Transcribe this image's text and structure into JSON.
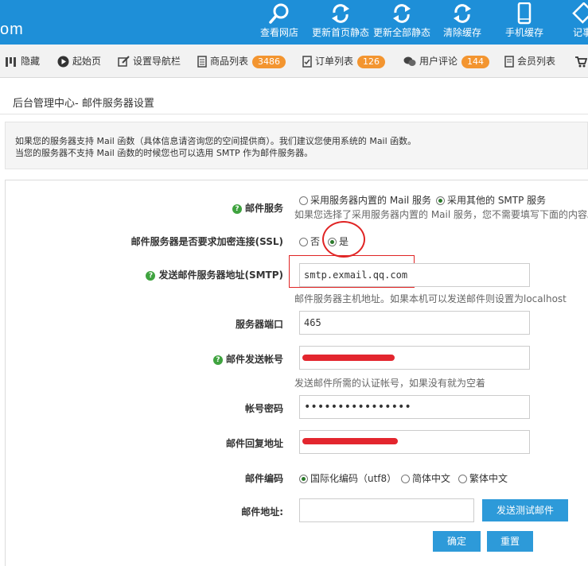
{
  "header": {
    "brand": "om",
    "items": [
      {
        "label": "查看网店",
        "icon": "search-icon"
      },
      {
        "label": "更新首页静态",
        "icon": "refresh-icon"
      },
      {
        "label": "更新全部静态",
        "icon": "refresh-icon"
      },
      {
        "label": "清除缓存",
        "icon": "refresh-icon"
      },
      {
        "label": "手机缓存",
        "icon": "mobile-icon"
      },
      {
        "label": "记事",
        "icon": "note-icon"
      }
    ]
  },
  "nav": {
    "items": [
      {
        "label": "隐藏",
        "icon": "hide-icon"
      },
      {
        "label": "起始页",
        "icon": "play-icon"
      },
      {
        "label": "设置导航栏",
        "icon": "edit-icon"
      },
      {
        "label": "商品列表",
        "badge": "3486",
        "icon": "list-icon"
      },
      {
        "label": "订单列表",
        "badge": "126",
        "icon": "order-icon"
      },
      {
        "label": "用户评论",
        "badge": "144",
        "icon": "comment-icon"
      },
      {
        "label": "会员列表",
        "icon": "member-icon"
      }
    ]
  },
  "page": {
    "title": "后台管理中心- 邮件服务器设置",
    "info_line1": "如果您的服务器支持 Mail 函数（具体信息请咨询您的空间提供商）。我们建议您使用系统的 Mail 函数。",
    "info_line2": "当您的服务器不支持 Mail 函数的时候您也可以选用 SMTP 作为邮件服务器。"
  },
  "form": {
    "mail_service": {
      "label": "邮件服务",
      "opt_builtin": "采用服务器内置的 Mail 服务",
      "opt_smtp": "采用其他的 SMTP 服务",
      "selected": "smtp",
      "note": "如果您选择了采用服务器内置的 Mail 服务，您不需要填写下面的内容。"
    },
    "ssl": {
      "label": "邮件服务器是否要求加密连接(SSL)",
      "opt_no": "否",
      "opt_yes": "是",
      "selected": "yes"
    },
    "smtp_host": {
      "label": "发送邮件服务器地址(SMTP)",
      "value": "smtp.exmail.qq.com",
      "note": "邮件服务器主机地址。如果本机可以发送邮件则设置为localhost"
    },
    "port": {
      "label": "服务器端口",
      "value": "465"
    },
    "account": {
      "label": "邮件发送帐号",
      "value": "",
      "note": "发送邮件所需的认证帐号，如果没有就为空着"
    },
    "password": {
      "label": "帐号密码",
      "value": "••••••••••••••••"
    },
    "reply": {
      "label": "邮件回复地址",
      "value": ""
    },
    "encoding": {
      "label": "邮件编码",
      "opt_utf8": "国际化编码（utf8）",
      "opt_gbk": "简体中文",
      "opt_big5": "繁体中文",
      "selected": "utf8"
    },
    "test": {
      "label": "邮件地址:",
      "value": "",
      "button": "发送测试邮件"
    },
    "submit_label": "确定",
    "reset_label": "重置"
  },
  "colors": {
    "header_bg": "#1e8fd8",
    "badge": "#f39530",
    "button": "#2d9ad9",
    "annotation": "#e02424",
    "help_icon": "#3fa33f"
  }
}
